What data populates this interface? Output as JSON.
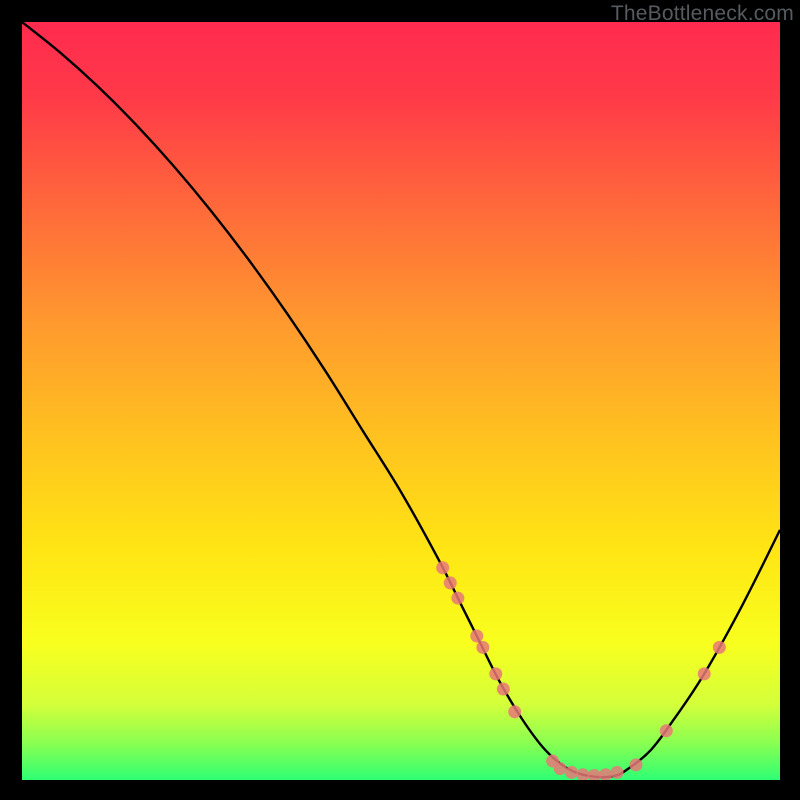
{
  "watermark": "TheBottleneck.com",
  "chart_data": {
    "type": "line",
    "title": "",
    "xlabel": "",
    "ylabel": "",
    "xlim": [
      0,
      100
    ],
    "ylim": [
      0,
      100
    ],
    "grid": false,
    "colors": {
      "gradient_top": "#ff2a4f",
      "gradient_mid": "#ffd400",
      "gradient_bottom": "#2eff74",
      "curve": "#000000",
      "marker": "#e87878"
    },
    "series": [
      {
        "name": "bottleneck-curve",
        "x": [
          0,
          5,
          10,
          15,
          20,
          25,
          30,
          35,
          40,
          45,
          50,
          55,
          58,
          60,
          63,
          66,
          69,
          72,
          75,
          78,
          80,
          83,
          86,
          90,
          95,
          100
        ],
        "y": [
          100,
          96,
          91.5,
          86.5,
          81,
          75,
          68.5,
          61.5,
          54,
          46,
          38,
          29,
          23,
          19,
          13,
          8,
          4,
          1.5,
          0.5,
          0.5,
          1.5,
          4,
          8,
          14,
          23,
          33
        ]
      }
    ],
    "markers": [
      {
        "x": 55.5,
        "y": 28
      },
      {
        "x": 56.5,
        "y": 26
      },
      {
        "x": 57.5,
        "y": 24
      },
      {
        "x": 60.0,
        "y": 19
      },
      {
        "x": 60.8,
        "y": 17.5
      },
      {
        "x": 62.5,
        "y": 14
      },
      {
        "x": 63.5,
        "y": 12
      },
      {
        "x": 65.0,
        "y": 9
      },
      {
        "x": 70.0,
        "y": 2.5
      },
      {
        "x": 71.0,
        "y": 1.5
      },
      {
        "x": 72.5,
        "y": 1.0
      },
      {
        "x": 74.0,
        "y": 0.7
      },
      {
        "x": 75.5,
        "y": 0.6
      },
      {
        "x": 77.0,
        "y": 0.7
      },
      {
        "x": 78.5,
        "y": 1.0
      },
      {
        "x": 81.0,
        "y": 2.0
      },
      {
        "x": 85.0,
        "y": 6.5
      },
      {
        "x": 90.0,
        "y": 14
      },
      {
        "x": 92.0,
        "y": 17.5
      }
    ]
  }
}
